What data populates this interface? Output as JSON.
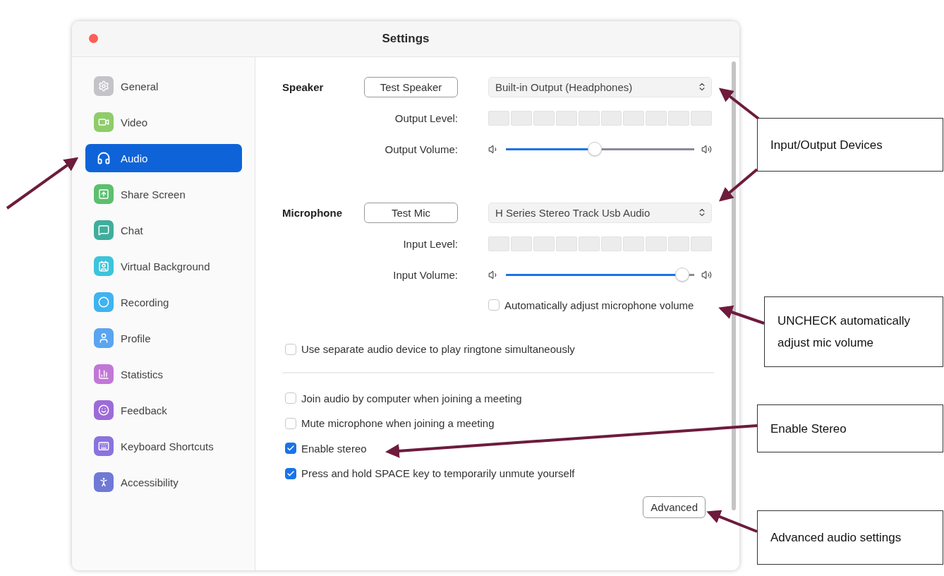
{
  "window": {
    "title": "Settings"
  },
  "sidebar": {
    "items": [
      {
        "label": "General",
        "selected": false,
        "color": "#c4c4c8"
      },
      {
        "label": "Video",
        "selected": false,
        "color": "#8fcc6a"
      },
      {
        "label": "Audio",
        "selected": true,
        "color": "#ffffff"
      },
      {
        "label": "Share Screen",
        "selected": false,
        "color": "#5cbf6e"
      },
      {
        "label": "Chat",
        "selected": false,
        "color": "#3fae9c"
      },
      {
        "label": "Virtual Background",
        "selected": false,
        "color": "#3cc4dc"
      },
      {
        "label": "Recording",
        "selected": false,
        "color": "#3fb3f0"
      },
      {
        "label": "Profile",
        "selected": false,
        "color": "#5aa4f0"
      },
      {
        "label": "Statistics",
        "selected": false,
        "color": "#c177d6"
      },
      {
        "label": "Feedback",
        "selected": false,
        "color": "#9d6bd8"
      },
      {
        "label": "Keyboard Shortcuts",
        "selected": false,
        "color": "#8b72de"
      },
      {
        "label": "Accessibility",
        "selected": false,
        "color": "#6f79d6"
      }
    ]
  },
  "speaker": {
    "label": "Speaker",
    "test_button": "Test Speaker",
    "device": "Built-in Output (Headphones)",
    "level_label": "Output Level:",
    "volume_label": "Output Volume:",
    "volume": {
      "level": 0.47
    }
  },
  "microphone": {
    "label": "Microphone",
    "test_button": "Test Mic",
    "device": "H Series Stereo Track Usb Audio",
    "level_label": "Input Level:",
    "volume_label": "Input Volume:",
    "volume": {
      "level": 0.97
    }
  },
  "auto_adjust": {
    "label": "Automatically adjust microphone volume",
    "checked": false
  },
  "ringtone": {
    "label": "Use separate audio device to play ringtone simultaneously",
    "checked": false
  },
  "options": [
    {
      "label": "Join audio by computer when joining a meeting",
      "checked": false
    },
    {
      "label": "Mute microphone when joining a meeting",
      "checked": false
    },
    {
      "label": "Enable stereo",
      "checked": true
    },
    {
      "label": "Press and hold SPACE key to temporarily unmute yourself",
      "checked": true
    }
  ],
  "advanced_button": "Advanced",
  "annotations": [
    {
      "text": "Input/Output Devices"
    },
    {
      "text": "UNCHECK automatically adjust mic volume"
    },
    {
      "text": "Enable Stereo"
    },
    {
      "text": "Advanced audio settings"
    }
  ]
}
